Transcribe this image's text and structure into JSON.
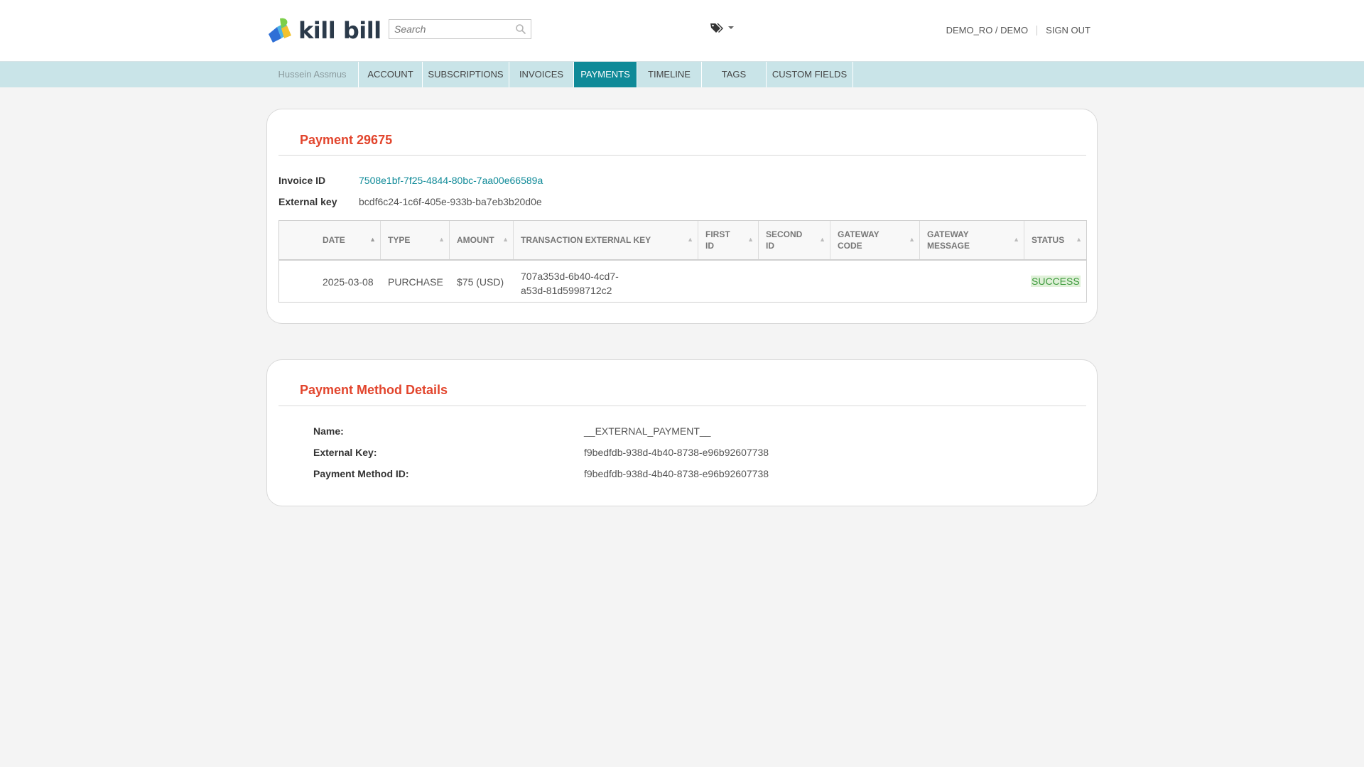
{
  "header": {
    "brand": "kill bill",
    "search_placeholder": "Search",
    "user": "DEMO_RO / DEMO",
    "sign_out": "SIGN OUT"
  },
  "nav": {
    "account_name": "Hussein Assmus",
    "tabs": [
      "ACCOUNT",
      "SUBSCRIPTIONS",
      "INVOICES",
      "PAYMENTS",
      "TIMELINE",
      "TAGS",
      "CUSTOM FIELDS"
    ],
    "active": "PAYMENTS"
  },
  "payment": {
    "title": "Payment 29675",
    "invoice_id_label": "Invoice ID",
    "invoice_id": "7508e1bf-7f25-4844-80bc-7aa00e66589a",
    "external_key_label": "External key",
    "external_key": "bcdf6c24-1c6f-405e-933b-ba7eb3b20d0e",
    "columns": {
      "date": "DATE",
      "type": "TYPE",
      "amount": "AMOUNT",
      "tx_key": "TRANSACTION EXTERNAL KEY",
      "first_id_1": "FIRST",
      "first_id_2": "ID",
      "second_id_1": "SECOND",
      "second_id_2": "ID",
      "gw_code_1": "GATEWAY",
      "gw_code_2": "CODE",
      "gw_msg_1": "GATEWAY",
      "gw_msg_2": "MESSAGE",
      "status": "STATUS"
    },
    "transactions": [
      {
        "date": "2025-03-08",
        "type": "PURCHASE",
        "amount": "$75 (USD)",
        "tx_key_line1": "707a353d-6b40-4cd7-",
        "tx_key_line2": "a53d-81d5998712c2",
        "first_id": "",
        "second_id": "",
        "gateway_code": "",
        "gateway_message": "",
        "status": "SUCCESS"
      }
    ]
  },
  "payment_method": {
    "title": "Payment Method Details",
    "name_label": "Name:",
    "name": "__EXTERNAL_PAYMENT__",
    "external_key_label": "External Key:",
    "external_key": "f9bedfdb-938d-4b40-8738-e96b92607738",
    "pm_id_label": "Payment Method ID:",
    "pm_id": "f9bedfdb-938d-4b40-8738-e96b92607738"
  },
  "colors": {
    "accent": "#0f8a98",
    "title_red": "#e2452d",
    "nav_bg": "#c9e4e8",
    "success_bg": "#dff0d8"
  }
}
